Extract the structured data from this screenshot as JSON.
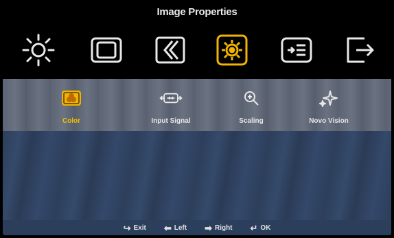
{
  "title": "Image Properties",
  "main_menu": [
    {
      "icon": "brightness-icon",
      "selected": false
    },
    {
      "icon": "display-frame-icon",
      "selected": false
    },
    {
      "icon": "sharpness-icon",
      "selected": false
    },
    {
      "icon": "image-properties-icon",
      "selected": true
    },
    {
      "icon": "menu-list-icon",
      "selected": false
    },
    {
      "icon": "exit-icon",
      "selected": false
    }
  ],
  "sub_menu": [
    {
      "label": "Color",
      "icon": "color-icon",
      "active": true
    },
    {
      "label": "Input Signal",
      "icon": "input-signal-icon",
      "active": false
    },
    {
      "label": "Scaling",
      "icon": "scaling-icon",
      "active": false
    },
    {
      "label": "Novo Vision",
      "icon": "novo-vision-icon",
      "active": false
    }
  ],
  "footer": {
    "exit": {
      "glyph": "↪",
      "label": "Exit"
    },
    "left": {
      "glyph": "⬅",
      "label": "Left"
    },
    "right": {
      "glyph": "➡",
      "label": "Right"
    },
    "ok": {
      "glyph": "↵",
      "label": "OK"
    }
  },
  "colors": {
    "accent": "#f0b400",
    "icon_white": "#e8e8e8",
    "background": "#000000"
  }
}
